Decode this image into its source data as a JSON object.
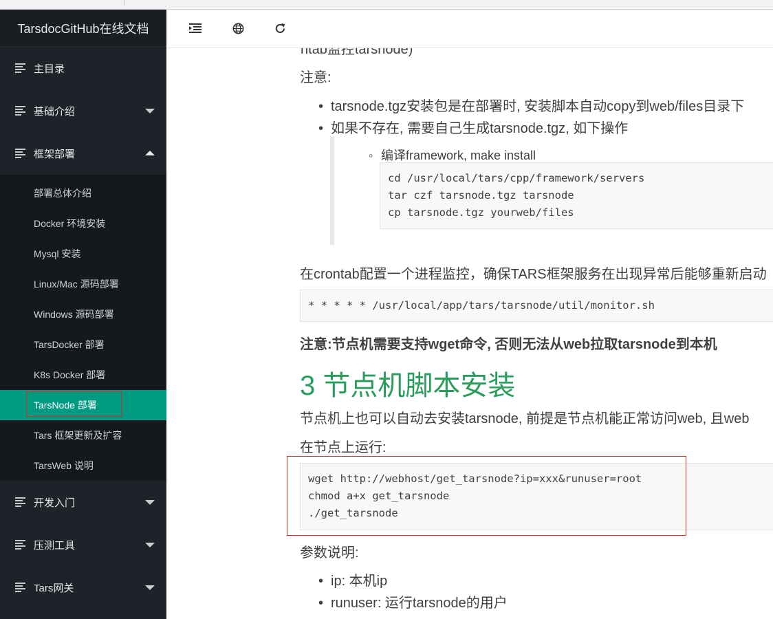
{
  "sidebar": {
    "brand": "TarsdocGitHub在线文档",
    "items": [
      {
        "label": "主目录"
      },
      {
        "label": "基础介绍"
      },
      {
        "label": "框架部署"
      },
      {
        "label": "开发入门"
      },
      {
        "label": "压测工具"
      },
      {
        "label": "Tars网关"
      }
    ],
    "submenu": [
      "部署总体介绍",
      "Docker 环境安装",
      "Mysql 安装",
      "Linux/Mac 源码部署",
      "Windows 源码部署",
      "TarsDocker 部署",
      "K8s Docker 部署",
      "TarsNode 部署",
      "Tars 框架更新及扩容",
      "TarsWeb 说明"
    ]
  },
  "topbar": {
    "menu_icon": "list-indent-icon",
    "globe_icon": "globe-icon",
    "refresh_icon": "refresh-icon"
  },
  "content": {
    "clipped_line": "ntab监控tarsnode)",
    "note_label": "注意:",
    "bullet1": "tarsnode.tgz安装包是在部署时, 安装脚本自动copy到web/files目录下",
    "bullet2": "如果不存在, 需要自己生成tarsnode.tgz, 如下操作",
    "sub_bullet": "编译framework, make install",
    "code1": "cd /usr/local/tars/cpp/framework/servers\ntar czf tarsnode.tgz tarsnode\ncp tarsnode.tgz yourweb/files",
    "crontab_text": "在crontab配置一个进程监控，确保TARS框架服务在出现异常后能够重新启动",
    "code2": "* * * * * /usr/local/app/tars/tarsnode/util/monitor.sh",
    "bold_note": "注意:节点机需要支持wget命令, 否则无法从web拉取tarsnode到本机",
    "heading": "3 节点机脚本安装",
    "script_intro": "节点机上也可以自动去安装tarsnode, 前提是节点机能正常访问web, 且web",
    "run_on_node": "在节点上运行:",
    "code3": "wget http://webhost/get_tarsnode?ip=xxx&runuser=root\nchmod a+x get_tarsnode\n./get_tarsnode",
    "params_label": "参数说明:",
    "param_ip": "ip: 本机ip",
    "param_runuser": "runuser: 运行tarsnode的用户"
  }
}
